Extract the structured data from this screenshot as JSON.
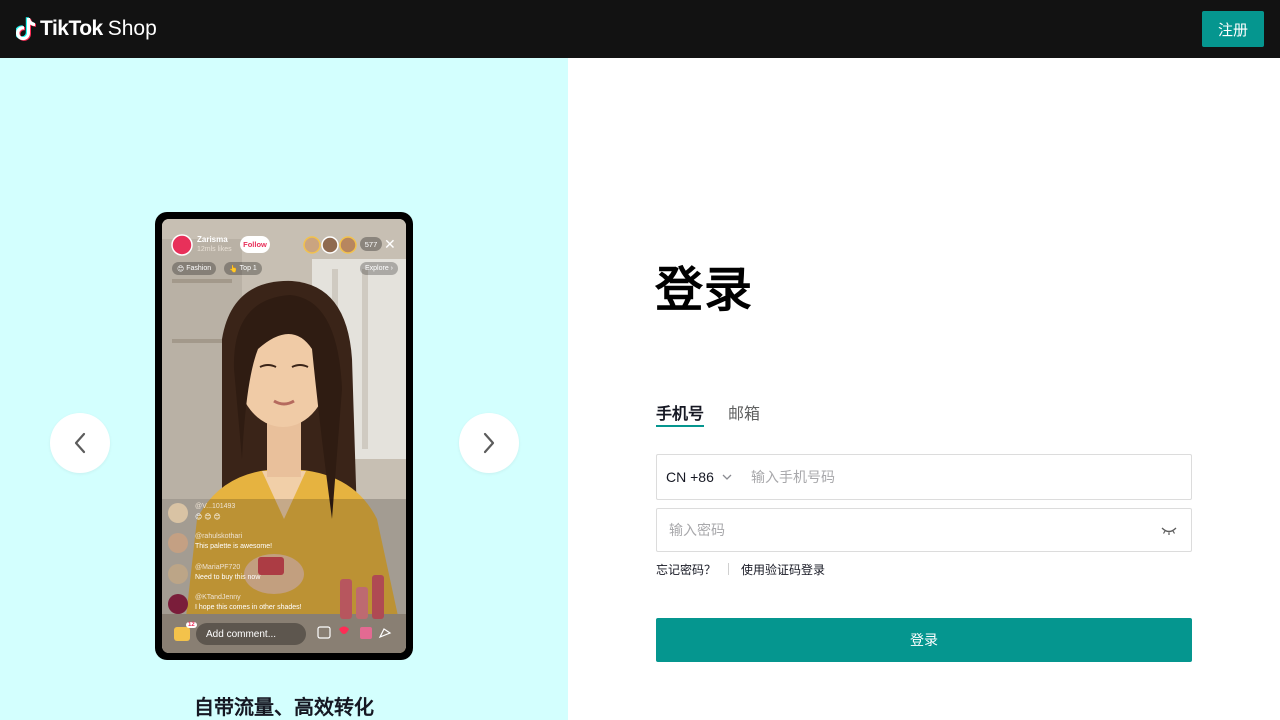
{
  "header": {
    "brand": "TikTok",
    "shop": "Shop",
    "register_label": "注册"
  },
  "carousel": {
    "caption": "自带流量、高效转化",
    "prev_icon": "chevron-left-icon",
    "next_icon": "chevron-right-icon",
    "live": {
      "streamer": "Zarisma",
      "streamer_sub": "12mls likes",
      "follow_label": "Follow",
      "viewer_count": "577",
      "tag_fashion": "Fashion",
      "tag_top": "Top 1",
      "explore_label": "Explore ›",
      "comments": [
        {
          "user": "@V...101493",
          "text": "😊 😊 😊"
        },
        {
          "user": "@rahulskothari",
          "text": "This palette is awesome!"
        },
        {
          "user": "@MariaPF720",
          "text": "Need to buy this now"
        },
        {
          "user": "@KTandJenny",
          "text": "I hope this comes in other shades!"
        }
      ],
      "cart_count": "12",
      "add_comment_placeholder": "Add comment..."
    }
  },
  "login": {
    "title": "登录",
    "tabs": [
      "手机号",
      "邮箱"
    ],
    "active_tab": "手机号",
    "country_code": "CN +86",
    "phone_placeholder": "输入手机号码",
    "password_placeholder": "输入密码",
    "forgot_password": "忘记密码？",
    "code_login": "使用验证码登录",
    "submit_label": "登录"
  },
  "colors": {
    "accent": "#05968f",
    "topbar": "#121212",
    "left_panel_bg": "#d3fffe"
  }
}
